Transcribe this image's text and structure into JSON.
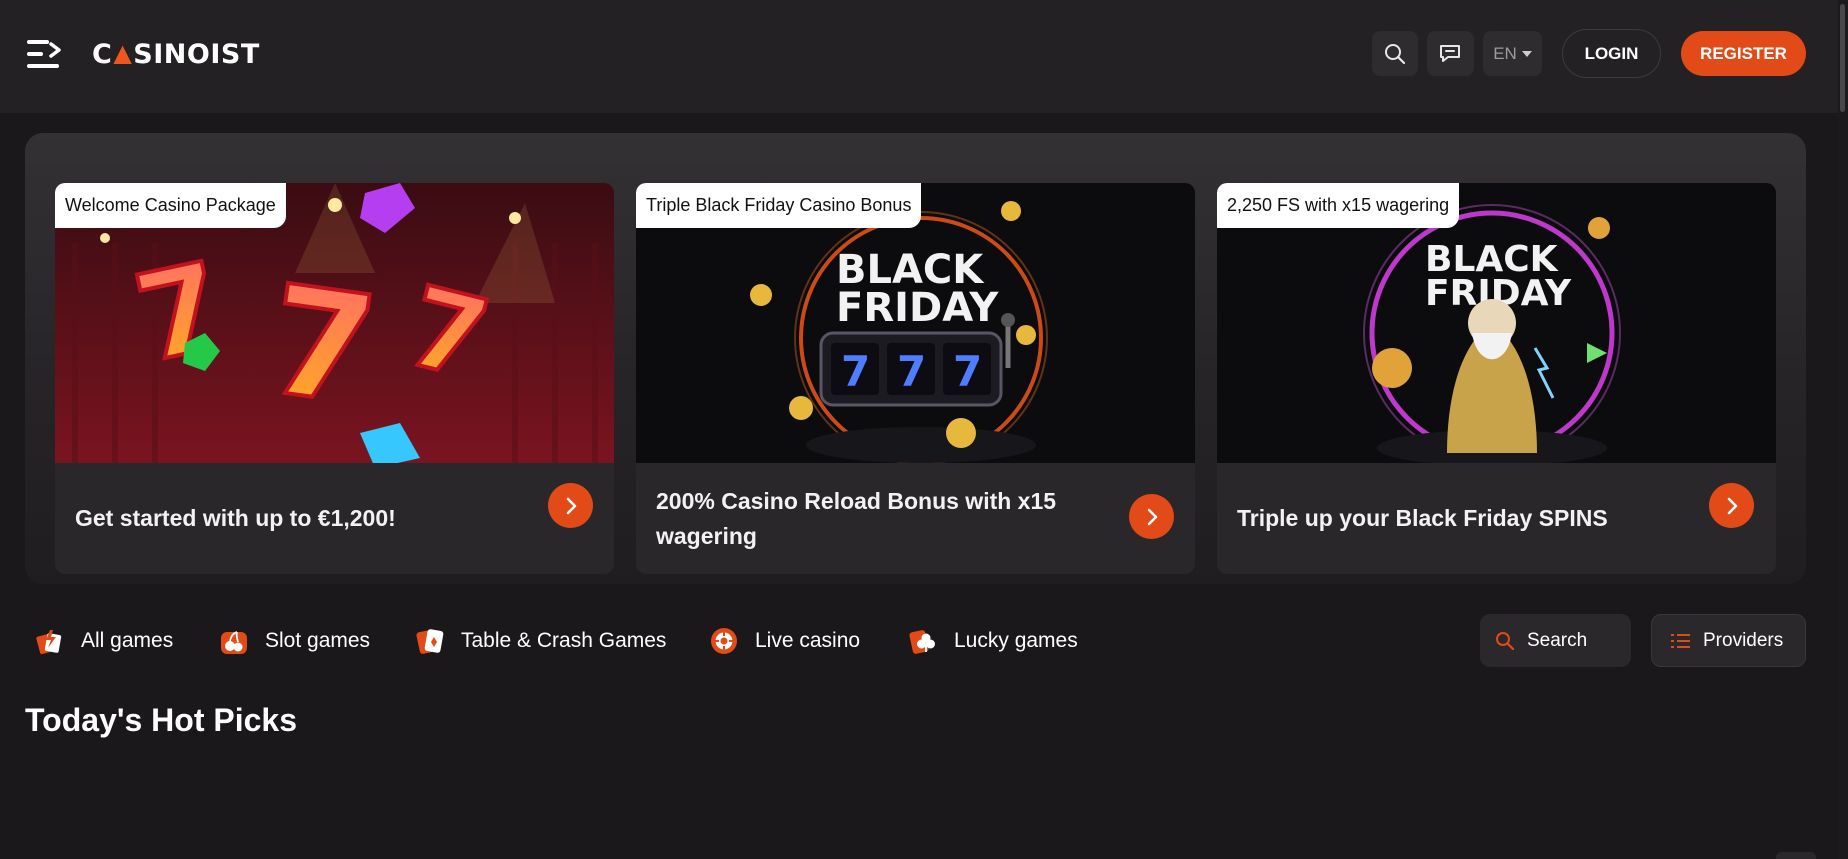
{
  "header": {
    "logo_text_left": "C",
    "logo_text_right": "SINOIST",
    "lang": "EN",
    "login_label": "LOGIN",
    "register_label": "REGISTER"
  },
  "promos": [
    {
      "badge": "Welcome Casino Package",
      "title": "Get started with up to €1,200!"
    },
    {
      "badge": "Triple Black Friday Casino Bonus",
      "title": "200% Casino Reload Bonus with x15 wagering",
      "art_text_1": "BLACK",
      "art_text_2": "FRIDAY"
    },
    {
      "badge": "2,250 FS with x15 wagering",
      "title": "Triple up your Black Friday SPINS",
      "art_text_1": "BLACK",
      "art_text_2": "FRIDAY"
    }
  ],
  "categories": [
    {
      "label": "All games",
      "icon": "lightning-cards-icon"
    },
    {
      "label": "Slot games",
      "icon": "cherries-icon"
    },
    {
      "label": "Table & Crash Games",
      "icon": "playing-card-icon"
    },
    {
      "label": "Live casino",
      "icon": "roulette-icon"
    },
    {
      "label": "Lucky games",
      "icon": "clover-icon"
    }
  ],
  "search_label": "Search",
  "providers_label": "Providers",
  "section_title": "Today's Hot Picks",
  "colors": {
    "accent": "#e24a18",
    "bg": "#1a181b",
    "header": "#232123"
  }
}
